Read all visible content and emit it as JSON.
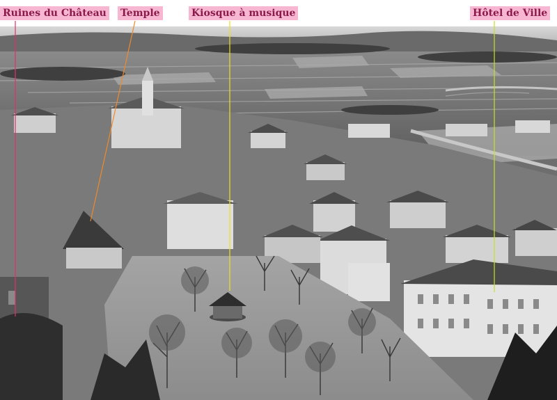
{
  "labels": {
    "ruines": "Ruines du Château",
    "temple": "Temple",
    "kiosque": "Kiosque à musique",
    "hotel": "Hôtel de Ville"
  },
  "colors": {
    "label_background": "#f7b7d3",
    "label_text": "#8b1a4a",
    "ruines_line": "#e0306a",
    "temple_line": "#f08a2a",
    "kiosque_line": "#f2e01a",
    "hotel_line": "#c8e02a"
  }
}
